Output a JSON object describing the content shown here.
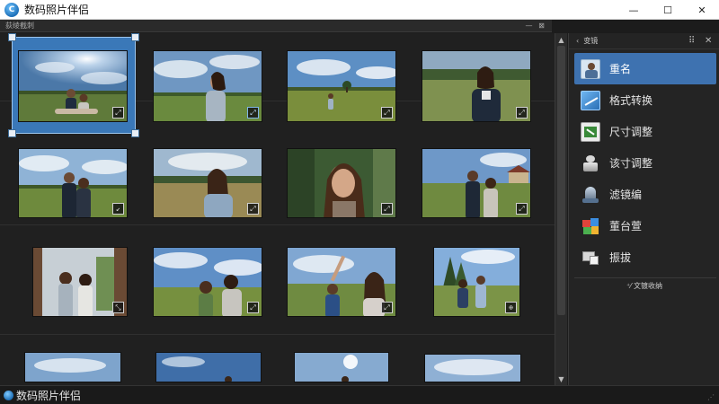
{
  "window": {
    "title": "数码照片伴侣",
    "icon": "app-logo-icon",
    "controls": [
      "—",
      "☐",
      "✕"
    ]
  },
  "subheader": {
    "label": "荻绫截刺",
    "minimize": "—",
    "close": "⊠"
  },
  "grid": {
    "thumbnails": [
      {
        "scene": "couple-field-sun",
        "badge": "⤢",
        "selected": true
      },
      {
        "scene": "woman-looking-up",
        "badge": "⤢",
        "badge_color": "blue"
      },
      {
        "scene": "woman-distant-field",
        "badge": "⤢"
      },
      {
        "scene": "woman-portrait-field",
        "badge": "⤢"
      },
      {
        "scene": "couple-standing",
        "badge": "↙"
      },
      {
        "scene": "woman-smiling-field",
        "badge": "⤢"
      },
      {
        "scene": "woman-closeup-trees",
        "badge": "⤢"
      },
      {
        "scene": "couple-village",
        "badge": "⤢"
      },
      {
        "scene": "women-doorway",
        "badge": "⤡"
      },
      {
        "scene": "mother-child",
        "badge": "⤢"
      },
      {
        "scene": "friends-waving",
        "badge": "⤢"
      },
      {
        "scene": "kids-trees",
        "badge": "⊕"
      },
      {
        "scene": "sky-partial-1",
        "badge": ""
      },
      {
        "scene": "sky-partial-2",
        "badge": ""
      },
      {
        "scene": "sky-partial-3",
        "badge": ""
      },
      {
        "scene": "sky-partial-4",
        "badge": ""
      }
    ]
  },
  "scrollbar": {
    "up": "▲",
    "down": "▼"
  },
  "panel": {
    "header_arrow": "‹",
    "header_label": "变镜",
    "header_icons": [
      "⠿",
      "✕"
    ],
    "items": [
      {
        "label": "重名",
        "icon": "portrait-thumb-icon",
        "active": true
      },
      {
        "label": "格式转换",
        "icon": "image-convert-icon",
        "active": false
      },
      {
        "label": "尺寸调整",
        "icon": "resize-icon",
        "active": false
      },
      {
        "label": "该寸调整",
        "icon": "stamp-icon",
        "active": false
      },
      {
        "label": "滤镜编",
        "icon": "bell-filter-icon",
        "active": false
      },
      {
        "label": "董台萱",
        "icon": "color-blocks-icon",
        "active": false
      },
      {
        "label": "振拔",
        "icon": "monitor-icon",
        "active": false
      }
    ],
    "footer": "⁺⁄ 文镀收纳"
  },
  "statusbar": {
    "text": "数码照片伴侣"
  },
  "colors": {
    "accent": "#3e72b0",
    "selection": "#3a78b8",
    "background": "#1c1c1c"
  }
}
